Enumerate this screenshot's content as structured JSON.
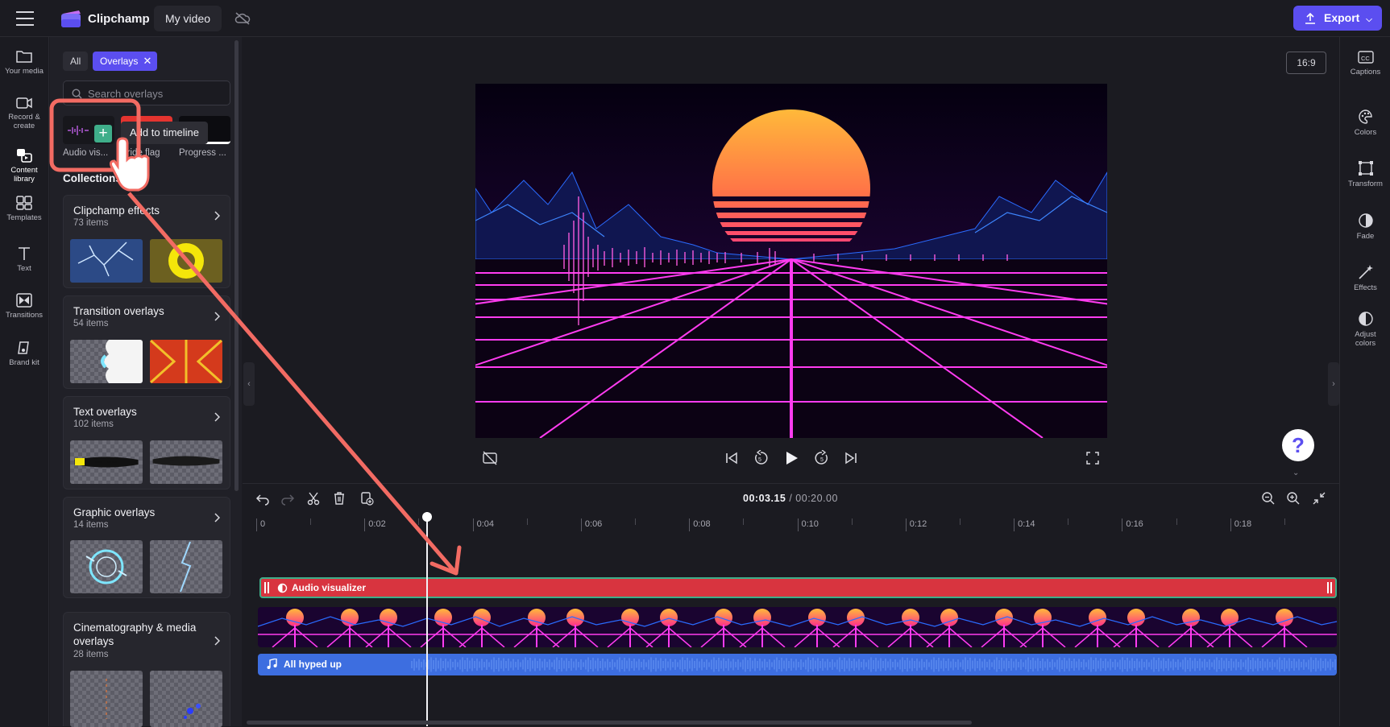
{
  "app": {
    "brand": "Clipchamp",
    "project_title": "My video",
    "export_label": "Export"
  },
  "left_nav": [
    {
      "label": "Your media",
      "icon": "folder-icon"
    },
    {
      "label": "Record &",
      "label2": "create",
      "icon": "camera-icon"
    },
    {
      "label": "Content",
      "label2": "library",
      "icon": "content-library-icon"
    },
    {
      "label": "Templates",
      "icon": "templates-icon"
    },
    {
      "label": "Text",
      "icon": "text-icon"
    },
    {
      "label": "Transitions",
      "icon": "transitions-icon"
    },
    {
      "label": "Brand kit",
      "icon": "brand-kit-icon"
    }
  ],
  "panel": {
    "filter_all": "All",
    "filter_active": "Overlays",
    "search_placeholder": "Search overlays",
    "top_items": [
      {
        "caption": "Audio vis..."
      },
      {
        "caption": "Pride flag"
      },
      {
        "caption": "Progress ..."
      }
    ],
    "tooltip": "Add to timeline",
    "collections_heading": "Collections",
    "collections": [
      {
        "title": "Clipchamp effects",
        "count": "73 items"
      },
      {
        "title": "Transition overlays",
        "count": "54 items"
      },
      {
        "title": "Text overlays",
        "count": "102 items"
      },
      {
        "title": "Graphic overlays",
        "count": "14 items"
      },
      {
        "title": "Cinematography & media overlays",
        "count": "28 items"
      }
    ]
  },
  "preview": {
    "aspect_ratio": "16:9"
  },
  "right_nav": [
    {
      "label": "Captions",
      "icon": "captions-icon"
    },
    {
      "label": "Colors",
      "icon": "palette-icon"
    },
    {
      "label": "Transform",
      "icon": "transform-icon"
    },
    {
      "label": "Fade",
      "icon": "fade-icon"
    },
    {
      "label": "Effects",
      "icon": "effects-wand-icon"
    },
    {
      "label": "Adjust",
      "label2": "colors",
      "icon": "adjust-colors-icon"
    }
  ],
  "timeline": {
    "current_time": "00:03.15",
    "total_time": "/ 00:20.00",
    "ticks": [
      "0",
      "0:02",
      "0:04",
      "0:06",
      "0:08",
      "0:10",
      "0:12",
      "0:14",
      "0:16",
      "0:18"
    ],
    "tracks": {
      "overlay_label": "Audio visualizer",
      "audio_label": "All hyped up"
    }
  },
  "colors": {
    "accent": "#5b4ef0",
    "overlay_track": "#d8343f",
    "audio_track": "#3d6ee0",
    "annotation": "#f26b63"
  }
}
